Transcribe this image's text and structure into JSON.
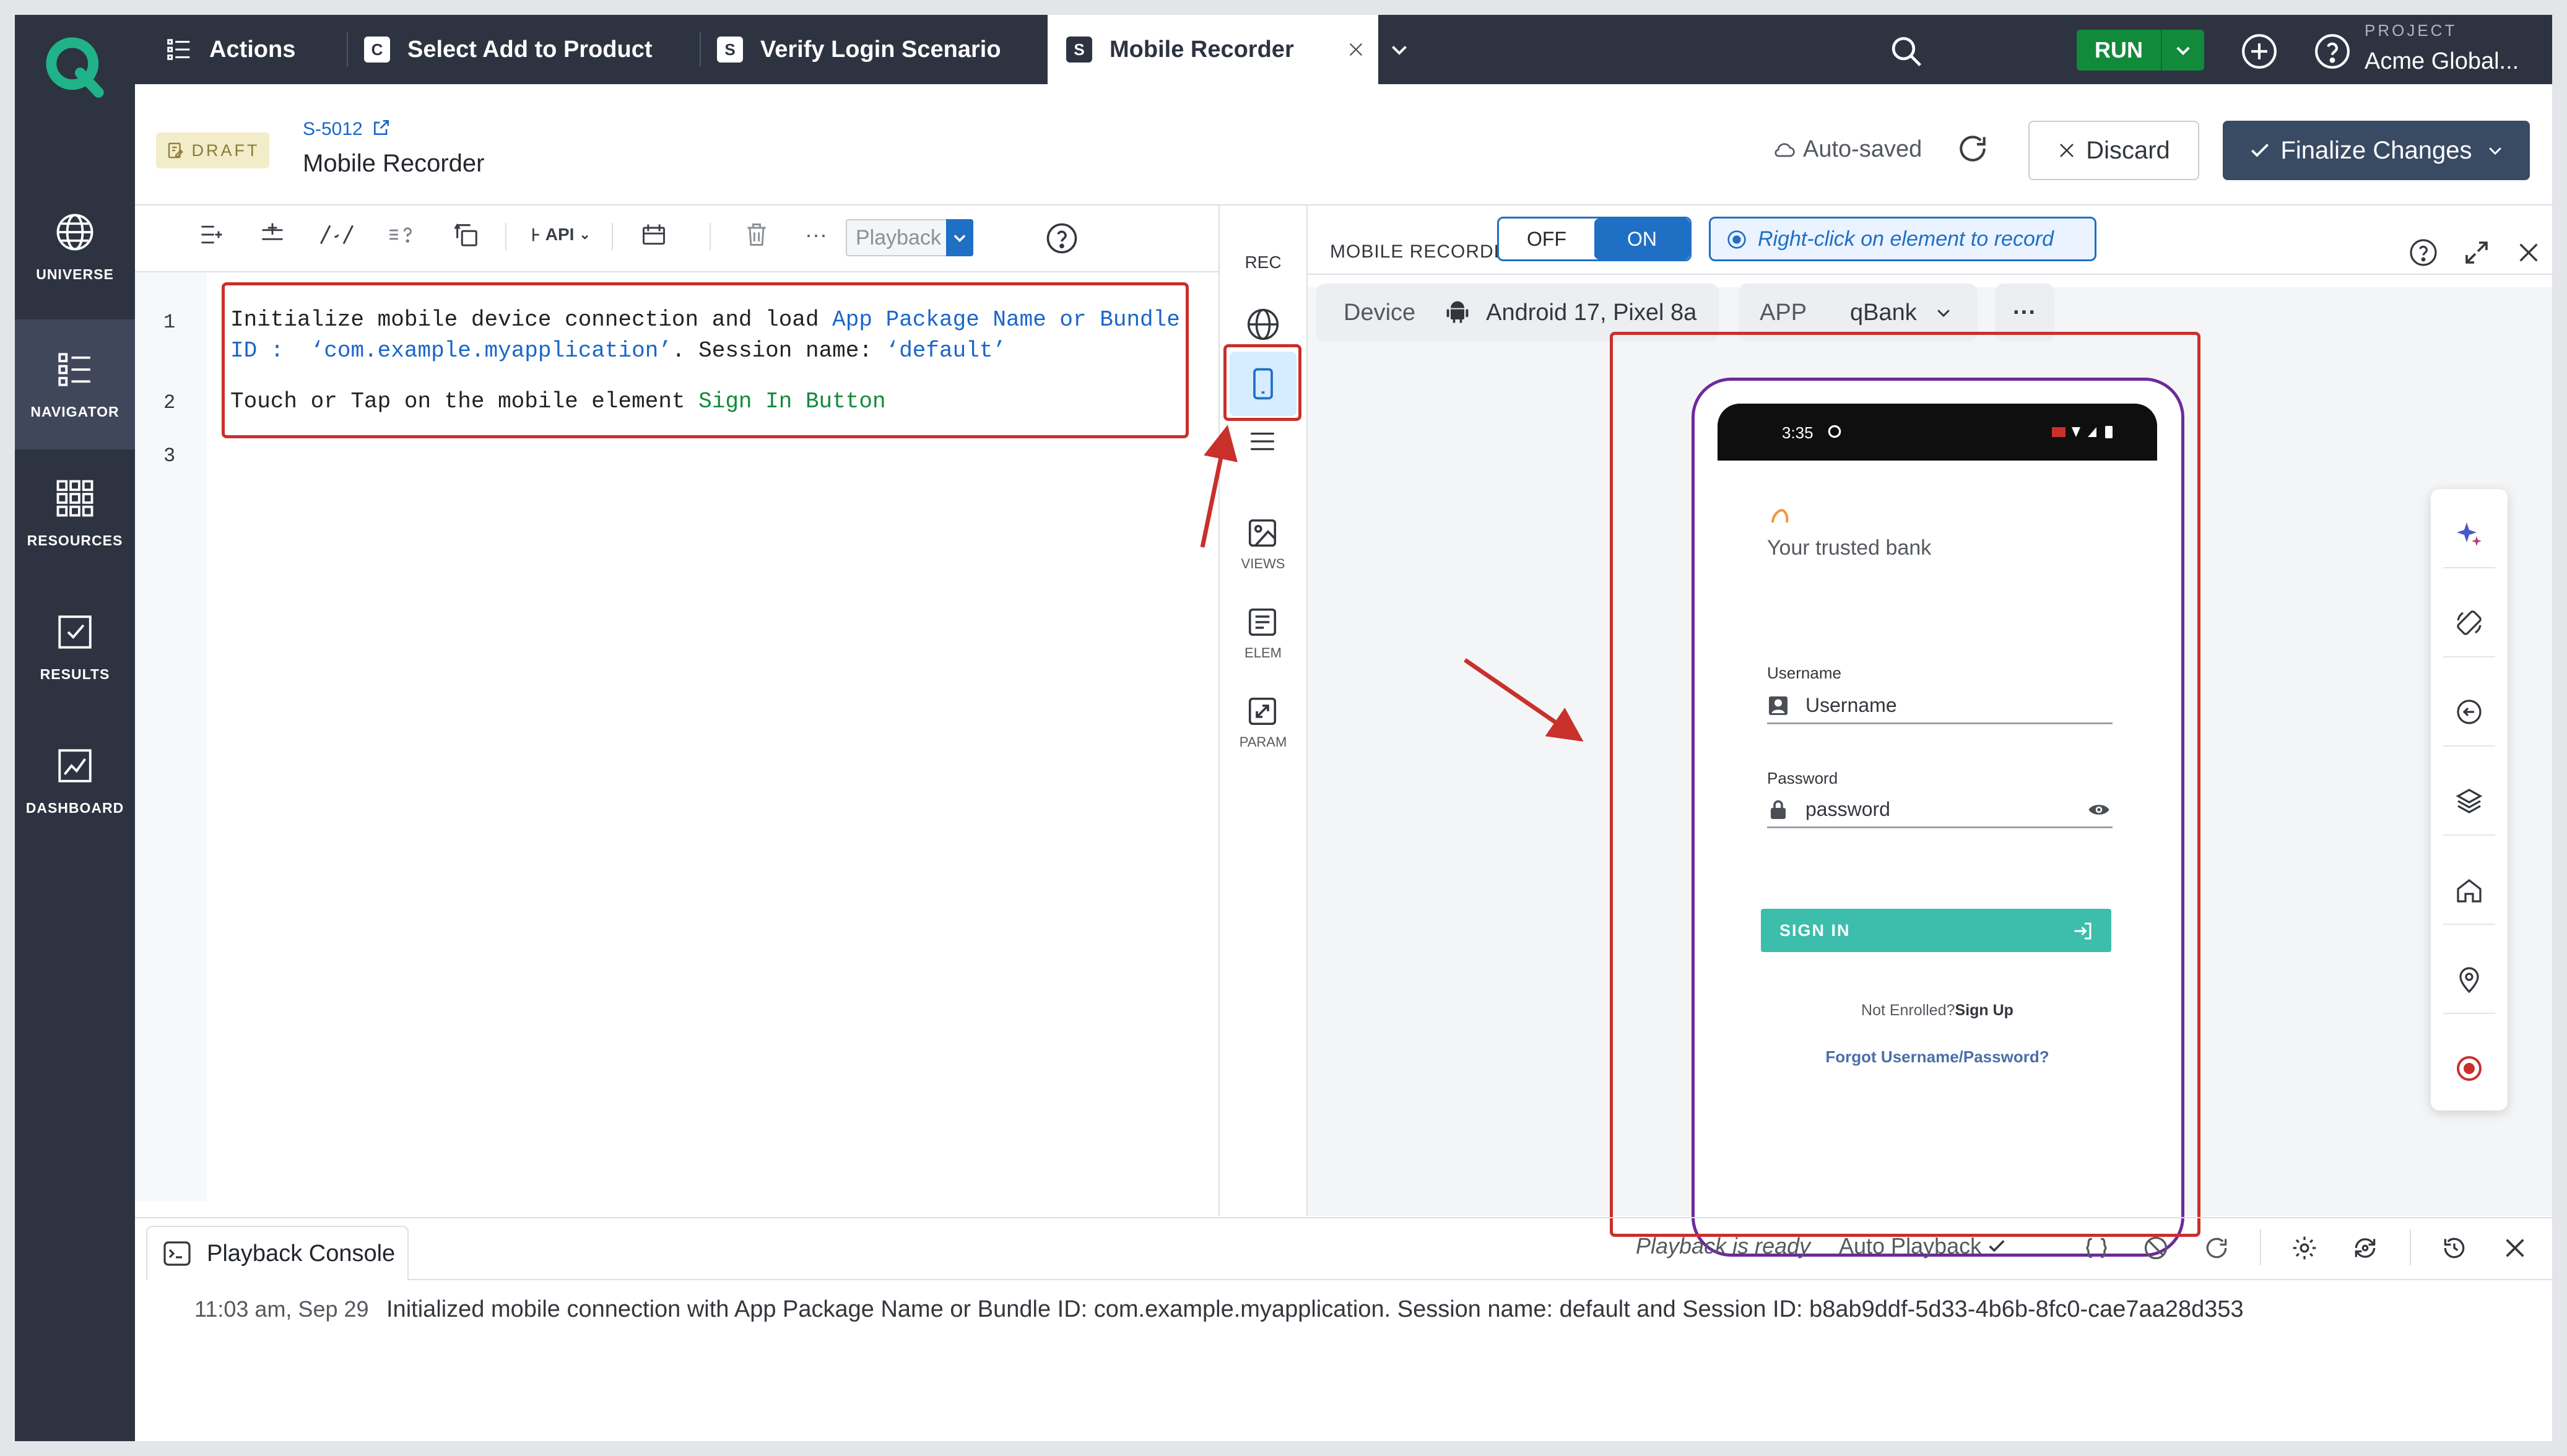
{
  "sidebar": {
    "items": [
      {
        "label": "UNIVERSE",
        "icon": "globe-icon"
      },
      {
        "label": "NAVIGATOR",
        "icon": "list-icon"
      },
      {
        "label": "RESOURCES",
        "icon": "grid-icon"
      },
      {
        "label": "RESULTS",
        "icon": "check-square-icon"
      },
      {
        "label": "DASHBOARD",
        "icon": "chart-icon"
      }
    ]
  },
  "topbar": {
    "tabs": [
      {
        "chip": "",
        "label": "Actions"
      },
      {
        "chip": "C",
        "label": "Select Add to Product"
      },
      {
        "chip": "S",
        "label": "Verify Login Scenario"
      },
      {
        "chip": "S",
        "label": "Mobile Recorder"
      }
    ],
    "run_label": "RUN",
    "project_label": "PROJECT",
    "project_value": "Acme Global..."
  },
  "header": {
    "status_badge": "DRAFT",
    "scenario_id": "S-5012",
    "title": "Mobile Recorder",
    "autosaved": "Auto-saved",
    "discard_label": "Discard",
    "finalize_label": "Finalize Changes"
  },
  "editor": {
    "toolbar": {
      "api_label": "API",
      "playback_placeholder": "Playback"
    },
    "line_numbers": [
      "1",
      "2",
      "3"
    ],
    "line1a_prefix": "Initialize mobile device connection and load ",
    "line1a_kw": "App Package Name or Bundle",
    "line1b_kw1": "ID : ",
    "line1b_val": "‘com.example.myapplication’",
    "line1b_mid": ". Session name: ",
    "line1b_val2": "‘default’",
    "line2_prefix": "Touch or Tap on the mobile element ",
    "line2_kw": "Sign In Button"
  },
  "tool_strip": {
    "rec": "REC",
    "views": "VIEWS",
    "elem": "ELEM",
    "param": "PARAM"
  },
  "recorder": {
    "label": "MOBILE RECORDER",
    "toggle_off": "OFF",
    "toggle_on": "ON",
    "hint": "Right-click on element to record",
    "device_label": "Device",
    "device_value": "Android 17, Pixel 8a",
    "app_label": "APP",
    "app_value": "qBank",
    "more": "···"
  },
  "phone": {
    "time": "3:35",
    "tagline": "Your trusted bank",
    "username_label": "Username",
    "username_placeholder": "Username",
    "password_label": "Password",
    "password_placeholder": "password",
    "signin_label": "SIGN IN",
    "not_enrolled": "Not Enrolled?",
    "signup": "Sign Up",
    "forgot": "Forgot Username/Password?"
  },
  "console": {
    "tab_label": "Playback Console",
    "status": "Playback is ready",
    "auto_playback": "Auto Playback",
    "log_time": "11:03 am, Sep 29",
    "log_message": "Initialized mobile connection with App Package Name or Bundle ID: com.example.myapplication. Session name: default and Session ID: b8ab9ddf-5d33-4b6b-8fc0-cae7aa28d353"
  },
  "colors": {
    "sidebar_bg": "#2e3341",
    "accent_blue": "#1f6fc4",
    "run_green": "#128a3c",
    "highlight_red": "#c9302c",
    "phone_frame": "#6c2a9c",
    "signin_teal": "#3dbdac"
  }
}
